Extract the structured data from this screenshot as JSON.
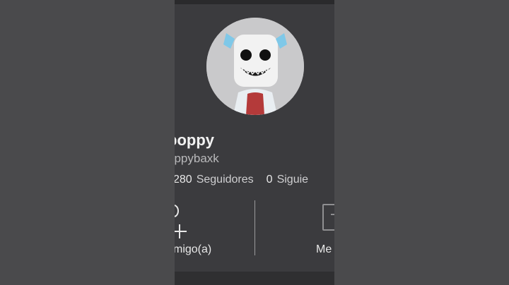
{
  "profile": {
    "display_name": "poppy",
    "username": "oppybaxk",
    "followers_count": "280",
    "followers_label": "Seguidores",
    "following_count": "0",
    "following_label": "Siguie"
  },
  "actions": {
    "add_friend_label": "migo(a)",
    "message_label": "Me"
  },
  "icons": {
    "add_friend": "plus-icon",
    "message": "message-icon"
  },
  "colors": {
    "background": "#4a4a4c",
    "panel": "#3b3b3e",
    "text_primary": "#f2f2f2",
    "text_secondary": "#b9b9bb",
    "divider": "#9a9a9c"
  }
}
